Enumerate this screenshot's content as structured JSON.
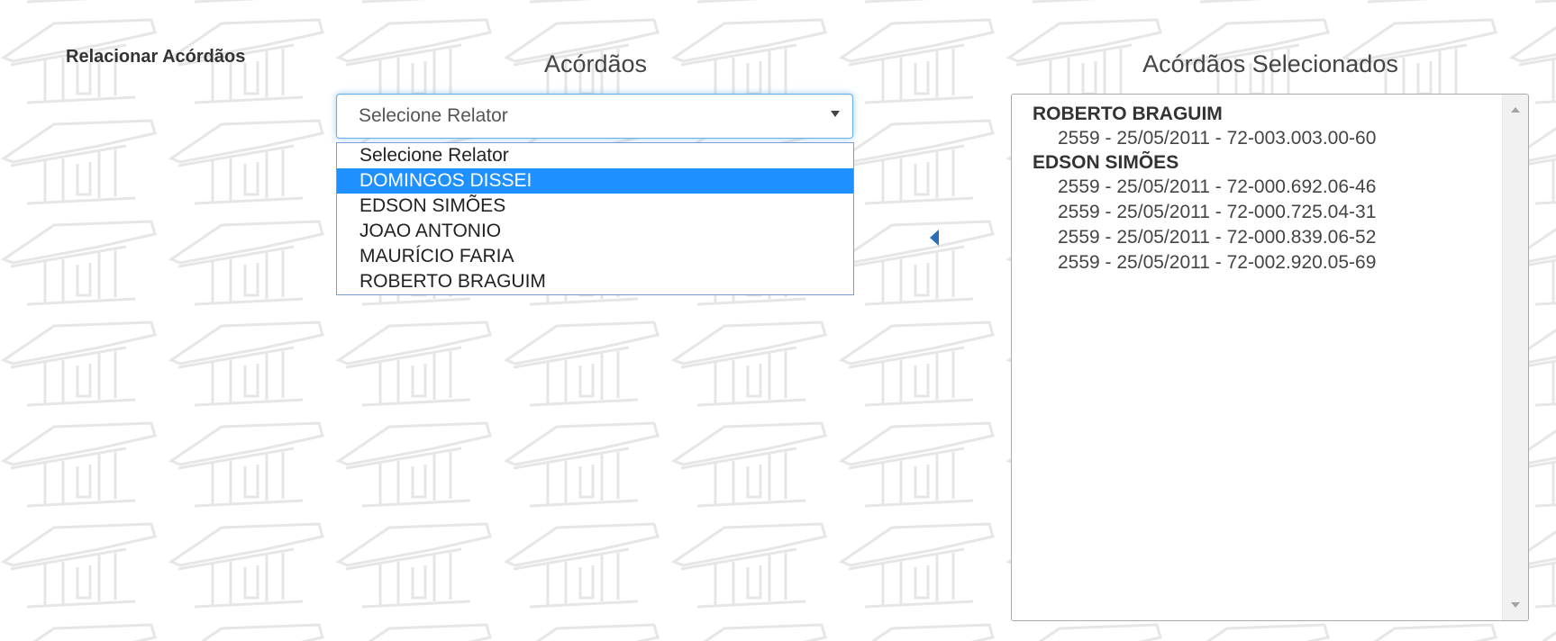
{
  "form": {
    "section_label": "Relacionar Acórdãos"
  },
  "left_column": {
    "title": "Acórdãos",
    "select": {
      "selected_value": "Selecione Relator",
      "options": [
        "Selecione Relator",
        "DOMINGOS DISSEI",
        "EDSON SIMÕES",
        "JOAO ANTONIO",
        "MAURÍCIO FARIA",
        "ROBERTO BRAGUIM"
      ],
      "highlighted_option": "DOMINGOS DISSEI"
    }
  },
  "transfer": {
    "icon": "caret-left-icon"
  },
  "right_column": {
    "title": "Acórdãos Selecionados",
    "groups": [
      {
        "relator": "ROBERTO BRAGUIM",
        "items": [
          "2559 - 25/05/2011 - 72-003.003.00-60"
        ]
      },
      {
        "relator": "EDSON SIMÕES",
        "items": [
          "2559 - 25/05/2011 - 72-000.692.06-46",
          "2559 - 25/05/2011 - 72-000.725.04-31",
          "2559 - 25/05/2011 - 72-000.839.06-52",
          "2559 - 25/05/2011 - 72-002.920.05-69"
        ]
      }
    ]
  },
  "colors": {
    "highlight": "#1e90ff",
    "focus_border": "#66afe9",
    "arrow": "#2a6fb8",
    "pattern": "#e9e9e9"
  }
}
